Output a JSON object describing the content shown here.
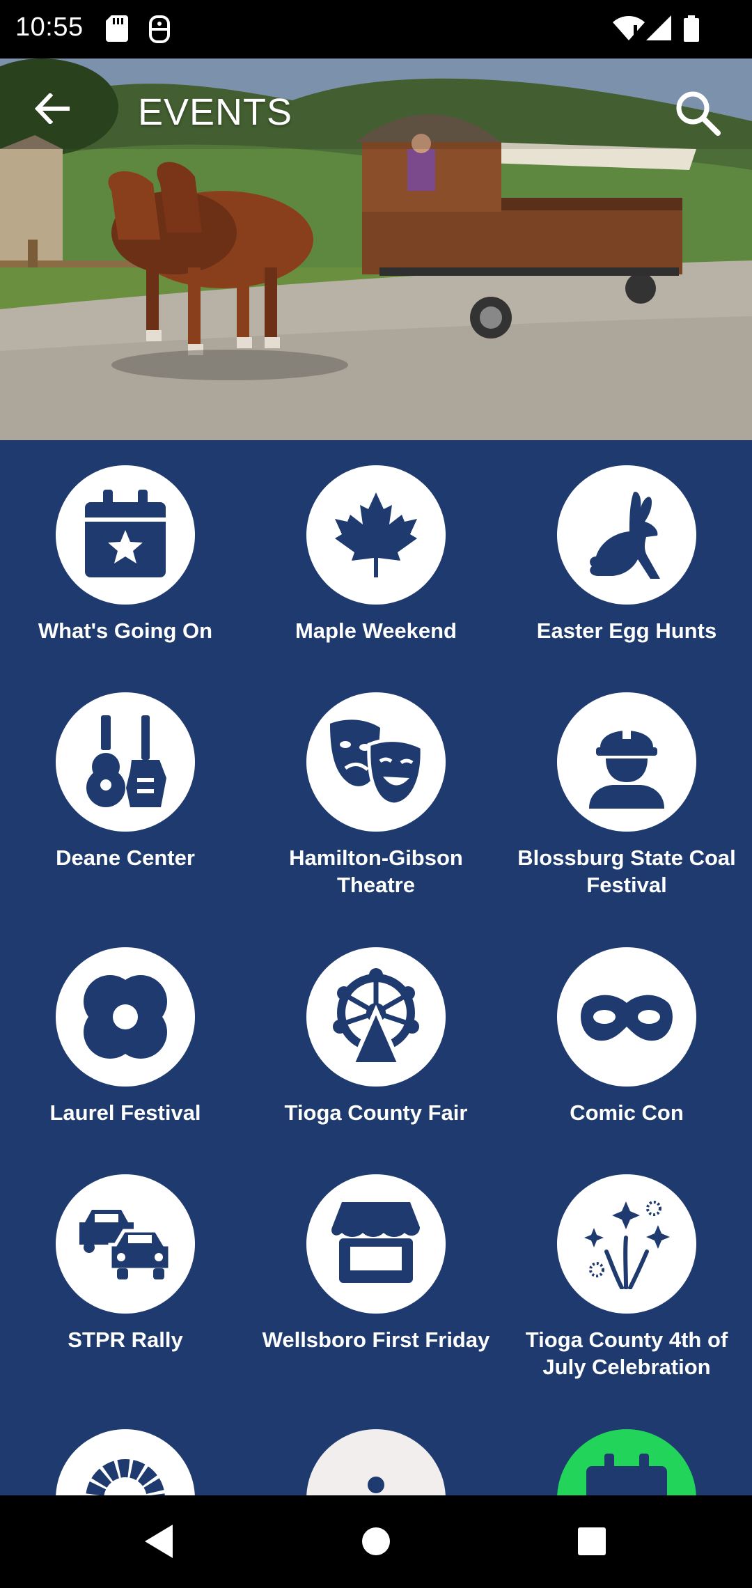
{
  "status_bar": {
    "time": "10:55",
    "icons": [
      "sd-card-icon",
      "assistant-icon",
      "wifi-icon",
      "signal-icon",
      "battery-icon"
    ]
  },
  "header": {
    "title": "EVENTS",
    "back_icon": "arrow-back-icon",
    "search_icon": "search-icon"
  },
  "events": [
    {
      "label": "What's Going On",
      "icon": "calendar-star-icon"
    },
    {
      "label": "Maple Weekend",
      "icon": "maple-leaf-icon"
    },
    {
      "label": "Easter Egg Hunts",
      "icon": "rabbit-icon"
    },
    {
      "label": "Deane Center",
      "icon": "guitars-icon"
    },
    {
      "label": "Hamilton-Gibson Theatre",
      "icon": "theater-masks-icon"
    },
    {
      "label": "Blossburg State Coal Festival",
      "icon": "hard-hat-worker-icon"
    },
    {
      "label": "Laurel Festival",
      "icon": "flower-icon"
    },
    {
      "label": "Tioga County Fair",
      "icon": "ferris-wheel-icon"
    },
    {
      "label": "Comic Con",
      "icon": "mask-icon"
    },
    {
      "label": "STPR Rally",
      "icon": "cars-icon"
    },
    {
      "label": "Wellsboro First Friday",
      "icon": "store-icon"
    },
    {
      "label": "Tioga County 4th of July Celebration",
      "icon": "fireworks-icon"
    },
    {
      "label": "",
      "icon": "wreath-icon"
    },
    {
      "label": "",
      "icon": "dots-icon"
    },
    {
      "label": "",
      "icon": "calendar-icon"
    }
  ],
  "nav_bar": {
    "back": "nav-back-icon",
    "home": "nav-home-icon",
    "recents": "nav-recents-icon"
  },
  "colors": {
    "grid_background": "#1e3a6e",
    "icon_blue": "#1e3a6e",
    "accent_green": "#22d45a"
  }
}
